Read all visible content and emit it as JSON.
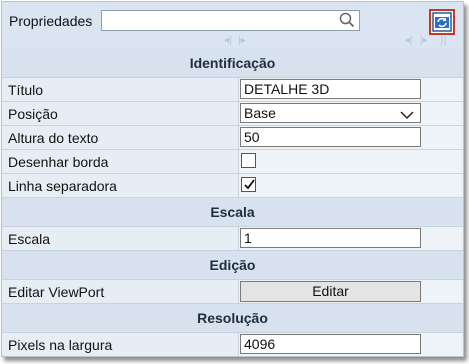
{
  "toolbar": {
    "title": "Propriedades",
    "search": {
      "value": "",
      "placeholder": ""
    },
    "search_icon": "magnifier-icon",
    "action_icon": "refresh-view-icon"
  },
  "sections": {
    "identificacao": {
      "title": "Identificação",
      "titulo_label": "Título",
      "titulo_value": "DETALHE 3D",
      "posicao_label": "Posição",
      "posicao_value": "Base",
      "altura_label": "Altura do texto",
      "altura_value": "50",
      "borda_label": "Desenhar borda",
      "borda_checked": false,
      "linha_label": "Linha separadora",
      "linha_checked": true
    },
    "escala": {
      "title": "Escala",
      "escala_label": "Escala",
      "escala_value": "1"
    },
    "edicao": {
      "title": "Edição",
      "viewport_label": "Editar ViewPort",
      "viewport_button": "Editar"
    },
    "resolucao": {
      "title": "Resolução",
      "pixels_label": "Pixels na largura",
      "pixels_value": "4096"
    }
  },
  "colors": {
    "panel_bg": "#dfe7f1",
    "section_bg": "#d8e2ee",
    "action_border": "#c0392b"
  }
}
